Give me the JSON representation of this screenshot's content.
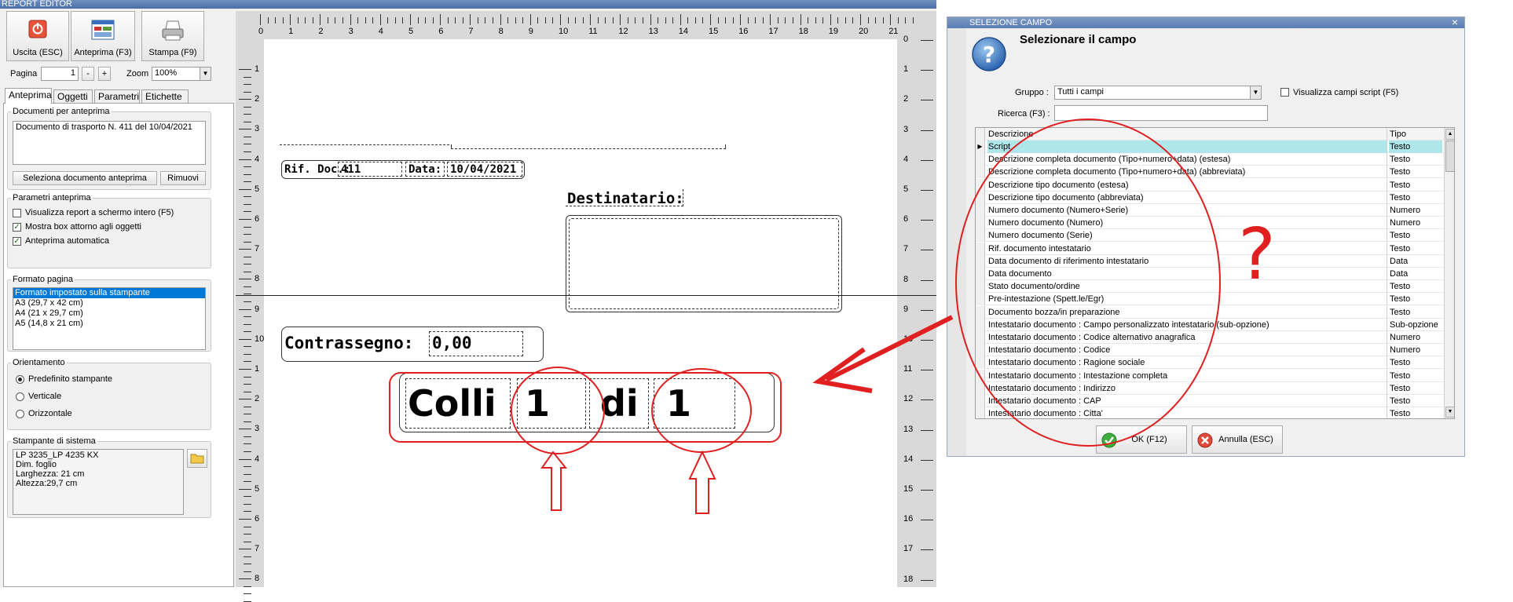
{
  "editor": {
    "title": "REPORT EDITOR",
    "toolbar": {
      "exit_label": "Uscita (ESC)",
      "preview_label": "Anteprima (F3)",
      "print_label": "Stampa (F9)"
    },
    "page_label": "Pagina",
    "page_value": "1",
    "page_minus": "-",
    "page_plus": "+",
    "zoom_label": "Zoom",
    "zoom_value": "100%",
    "tabs": [
      {
        "label": "Anteprima"
      },
      {
        "label": "Oggetti"
      },
      {
        "label": "Parametri"
      },
      {
        "label": "Etichette"
      }
    ],
    "docs_group": {
      "title": "Documenti per anteprima",
      "doc_text": "Documento di trasporto N. 411 del 10/04/2021",
      "select_button": "Seleziona documento anteprima",
      "remove_button": "Rimuovi"
    },
    "params_group": {
      "title": "Parametri anteprima",
      "options": [
        {
          "label": "Visualizza report a schermo intero (F5)",
          "checked": false
        },
        {
          "label": "Mostra box attorno agli oggetti",
          "checked": true
        },
        {
          "label": "Anteprima automatica",
          "checked": true
        }
      ]
    },
    "format_group": {
      "title": "Formato pagina",
      "items": [
        "Formato impostato sulla stampante",
        "A3 (29,7 x 42 cm)",
        "A4 (21 x 29,7 cm)",
        "A5 (14,8 x 21 cm)"
      ]
    },
    "orient_group": {
      "title": "Orientamento",
      "options": [
        {
          "label": "Predefinito stampante",
          "selected": true
        },
        {
          "label": "Verticale",
          "selected": false
        },
        {
          "label": "Orizzontale",
          "selected": false
        }
      ]
    },
    "printer_group": {
      "title": "Stampante di sistema",
      "lines": [
        "LP 3235_LP 4235 KX",
        "Dim. foglio",
        "Larghezza: 21 cm",
        "Altezza:29,7 cm"
      ]
    },
    "ruler_h": [
      "0",
      "1",
      "2",
      "3",
      "4",
      "5",
      "6",
      "7",
      "8",
      "9",
      "10",
      "11",
      "12",
      "13",
      "14",
      "15",
      "16",
      "17",
      "18",
      "19",
      "20",
      "21"
    ],
    "ruler_v_left": [
      "1",
      "2",
      "3",
      "4",
      "5",
      "6",
      "7",
      "8",
      "9",
      "10",
      "1",
      "2",
      "3",
      "4",
      "5",
      "6",
      "7",
      "8"
    ],
    "ruler_v_right": [
      "0",
      "1",
      "2",
      "3",
      "4",
      "5",
      "6",
      "7",
      "8",
      "9",
      "10",
      "11",
      "12",
      "13",
      "14",
      "15",
      "16",
      "17",
      "18"
    ],
    "report": {
      "rif_label": "Rif. Doc.:",
      "rif_value": "411",
      "data_label": "Data:",
      "data_value": "10/04/2021",
      "destinatario": "Destinatario:",
      "contrassegno_label": "Contrassegno:",
      "contrassegno_value": "0,00",
      "colli_label": "Colli",
      "colli_value": "1",
      "di_label": "di",
      "di_value": "1"
    }
  },
  "dialog": {
    "title": "SELEZIONE CAMPO",
    "close": "×",
    "heading": "Selezionare il campo",
    "help_icon_glyph": "?",
    "group_label": "Gruppo :",
    "group_value": "Tutti i campi",
    "script_checkbox": "Visualizza campi script (F5)",
    "search_label": "Ricerca (F3) :",
    "search_value": "",
    "columns": [
      "Descrizione",
      "Tipo"
    ],
    "rows": [
      [
        "Script",
        "Testo"
      ],
      [
        "Descrizione completa documento (Tipo+numero+data) (estesa)",
        "Testo"
      ],
      [
        "Descrizione completa documento (Tipo+numero+data) (abbreviata)",
        "Testo"
      ],
      [
        "Descrizione tipo documento (estesa)",
        "Testo"
      ],
      [
        "Descrizione tipo documento (abbreviata)",
        "Testo"
      ],
      [
        "Numero documento (Numero+Serie)",
        "Numero"
      ],
      [
        "Numero documento (Numero)",
        "Numero"
      ],
      [
        "Numero documento (Serie)",
        "Testo"
      ],
      [
        "Rif. documento intestatario",
        "Testo"
      ],
      [
        "Data documento di riferimento intestatario",
        "Data"
      ],
      [
        "Data documento",
        "Data"
      ],
      [
        "Stato documento/ordine",
        "Testo"
      ],
      [
        "Pre-intestazione (Spett.le/Egr)",
        "Testo"
      ],
      [
        "Documento bozza/in preparazione",
        "Testo"
      ],
      [
        "Intestatario documento : Campo personalizzato intestatario (sub-opzione)",
        "Sub-opzione"
      ],
      [
        "Intestatario documento : Codice alternativo anagrafica",
        "Numero"
      ],
      [
        "Intestatario documento : Codice",
        "Numero"
      ],
      [
        "Intestatario documento : Ragione sociale",
        "Testo"
      ],
      [
        "Intestatario documento : Intestazione completa",
        "Testo"
      ],
      [
        "Intestatario documento : Indirizzo",
        "Testo"
      ],
      [
        "Intestatario documento : CAP",
        "Testo"
      ],
      [
        "Intestatario documento : Citta'",
        "Testo"
      ]
    ],
    "ok_button": "OK (F12)",
    "cancel_button": "Annulla (ESC)"
  },
  "annotation": {
    "question_mark": "?",
    "color": "#e02020"
  }
}
